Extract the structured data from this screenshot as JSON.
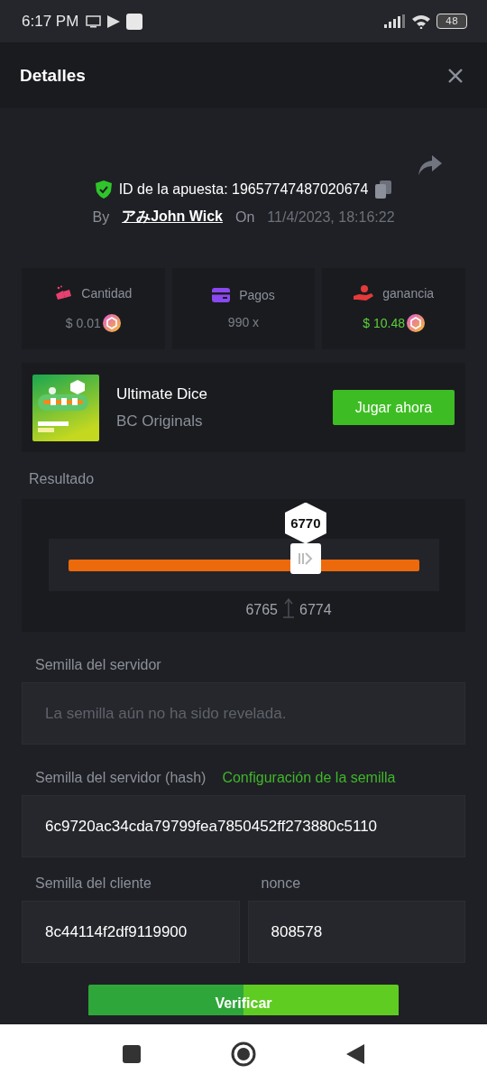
{
  "status_bar": {
    "time": "6:17 PM",
    "battery": "48"
  },
  "header": {
    "title": "Detalles"
  },
  "bet": {
    "id_label": "ID de la apuesta: 19657747487020674",
    "by_label": "By",
    "user": "アみJohn Wick",
    "on_label": "On",
    "date": "11/4/2023, 18:16:22"
  },
  "stats": [
    {
      "kind": "amount",
      "label": "Cantidad",
      "value": "$ 0.01",
      "coin": true,
      "positive": false
    },
    {
      "kind": "payout",
      "label": "Pagos",
      "value": "990 x",
      "coin": false,
      "positive": false
    },
    {
      "kind": "profit",
      "label": "ganancia",
      "value": "$ 10.48",
      "coin": true,
      "positive": true
    }
  ],
  "game": {
    "title": "Ultimate Dice",
    "provider": "BC Originals",
    "button": "Jugar ahora"
  },
  "result": {
    "label": "Resultado",
    "value": "6770",
    "level": 0.677,
    "low": "6765",
    "high": "6774"
  },
  "fields": [
    {
      "label": "Semilla del servidor",
      "placeholder": "La semilla aún no ha sido revelada."
    },
    {
      "label": "Semilla del servidor (hash)",
      "link": "Configuración de la semilla",
      "value": "6c9720ac34cda79799fea7850452ff273880c5110"
    }
  ],
  "client_fields": [
    {
      "label": "Semilla del cliente",
      "value": "8c44114f2df9119900"
    },
    {
      "label": "nonce",
      "value": "808578"
    }
  ],
  "verify_button": "Verificar"
}
